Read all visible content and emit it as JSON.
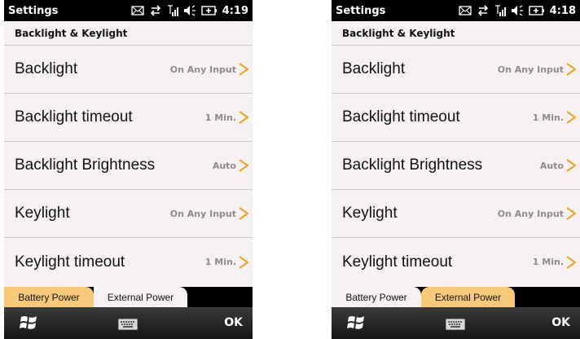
{
  "screens": [
    {
      "statusbar": {
        "title": "Settings",
        "time": "4:19"
      },
      "subheader": "Backlight & Keylight",
      "rows": [
        {
          "label": "Backlight",
          "value": "On Any Input"
        },
        {
          "label": "Backlight timeout",
          "value": "1 Min."
        },
        {
          "label": "Backlight Brightness",
          "value": "Auto"
        },
        {
          "label": "Keylight",
          "value": "On Any Input"
        },
        {
          "label": "Keylight timeout",
          "value": "1 Min."
        }
      ],
      "tabs": {
        "battery": "Battery Power",
        "external": "External Power",
        "active": "battery"
      },
      "menubar": {
        "ok": "OK"
      }
    },
    {
      "statusbar": {
        "title": "Settings",
        "time": "4:18"
      },
      "subheader": "Backlight & Keylight",
      "rows": [
        {
          "label": "Backlight",
          "value": "On Any Input"
        },
        {
          "label": "Backlight timeout",
          "value": "1 Min."
        },
        {
          "label": "Backlight Brightness",
          "value": "Auto"
        },
        {
          "label": "Keylight",
          "value": "On Any Input"
        },
        {
          "label": "Keylight timeout",
          "value": "1 Min."
        }
      ],
      "tabs": {
        "battery": "Battery Power",
        "external": "External Power",
        "active": "external"
      },
      "menubar": {
        "ok": "OK"
      }
    }
  ],
  "icons": {
    "statusbar": [
      "email-icon",
      "data-sync-icon",
      "signal-icon",
      "volume-icon",
      "battery-charging-icon"
    ],
    "row_arrow": "chevron-right-icon",
    "menubar": [
      "windows-start-icon",
      "keyboard-icon"
    ]
  },
  "colors": {
    "accent": "#f0a21e",
    "active_tab": "#f8c978",
    "background": "#f6f1f3"
  }
}
